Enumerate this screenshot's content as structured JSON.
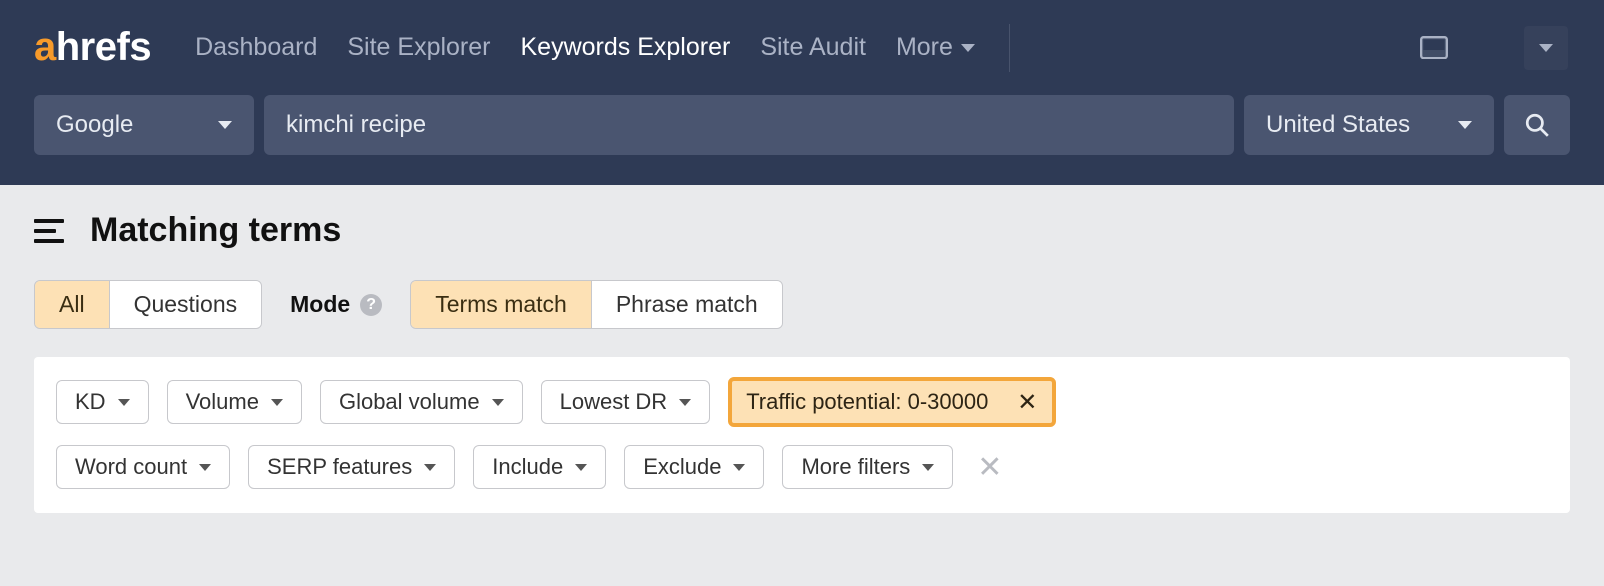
{
  "brand": {
    "a": "a",
    "rest": "hrefs"
  },
  "nav": {
    "items": [
      {
        "label": "Dashboard",
        "active": false
      },
      {
        "label": "Site Explorer",
        "active": false
      },
      {
        "label": "Keywords Explorer",
        "active": true
      },
      {
        "label": "Site Audit",
        "active": false
      },
      {
        "label": "More",
        "active": false,
        "has_caret": true
      }
    ]
  },
  "search": {
    "engine": "Google",
    "query": "kimchi recipe",
    "country": "United States"
  },
  "page": {
    "title": "Matching terms"
  },
  "tabs_type": [
    {
      "label": "All",
      "active": true
    },
    {
      "label": "Questions",
      "active": false
    }
  ],
  "mode_label": "Mode",
  "tabs_mode": [
    {
      "label": "Terms match",
      "active": true
    },
    {
      "label": "Phrase match",
      "active": false
    }
  ],
  "filters": {
    "row1": [
      {
        "label": "KD",
        "caret": true
      },
      {
        "label": "Volume",
        "caret": true
      },
      {
        "label": "Global volume",
        "caret": true
      },
      {
        "label": "Lowest DR",
        "caret": true
      },
      {
        "label": "Traffic potential: 0-30000",
        "caret": false,
        "active": true,
        "closable": true
      }
    ],
    "row2": [
      {
        "label": "Word count",
        "caret": true
      },
      {
        "label": "SERP features",
        "caret": true
      },
      {
        "label": "Include",
        "caret": true
      },
      {
        "label": "Exclude",
        "caret": true
      },
      {
        "label": "More filters",
        "caret": true
      }
    ]
  }
}
